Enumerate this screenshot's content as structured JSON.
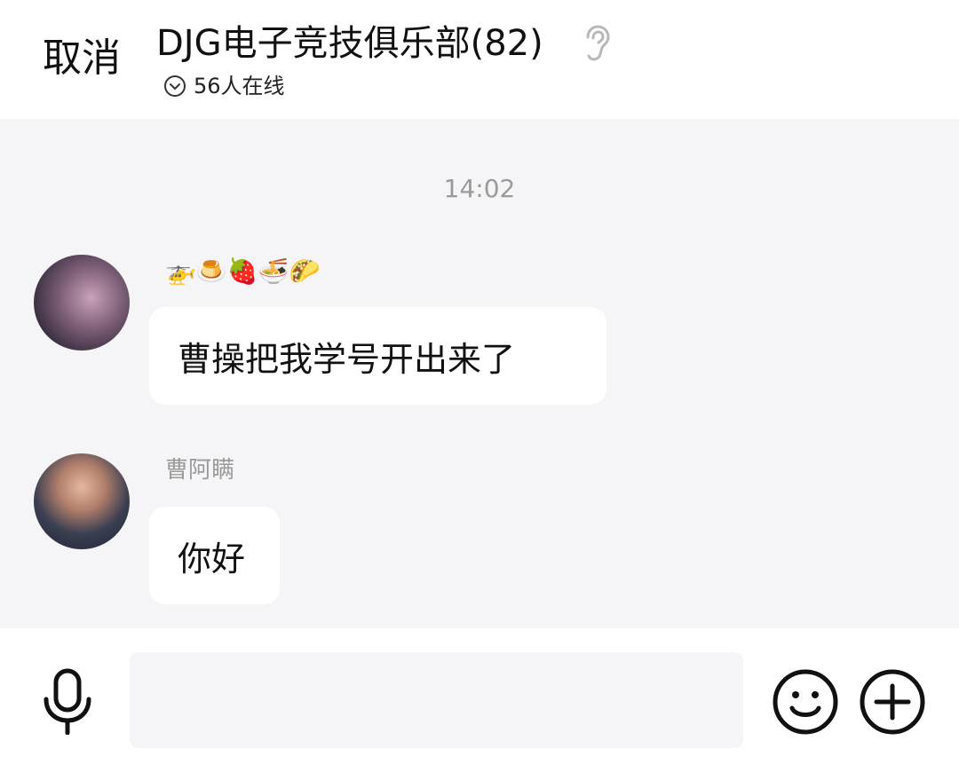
{
  "header": {
    "cancel_label": "取消",
    "group_title": "DJG电子竞技俱乐部(82)",
    "online_status": "56人在线"
  },
  "chat": {
    "timestamp": "14:02",
    "messages": [
      {
        "sender": "🚁🍮🍓🍜🌮",
        "text": "曹操把我学号开出来了"
      },
      {
        "sender": "曹阿瞒",
        "text": "你好"
      }
    ]
  },
  "input": {
    "value": "",
    "placeholder": ""
  },
  "icons": {
    "ear": "ear-icon",
    "online_toggle": "chevron-down-icon",
    "mic": "microphone-icon",
    "emoji": "smiley-icon",
    "more": "plus-icon"
  },
  "colors": {
    "chat_background": "#f5f4f6",
    "bubble_background": "#ffffff",
    "muted_text": "#9a9a9a"
  }
}
